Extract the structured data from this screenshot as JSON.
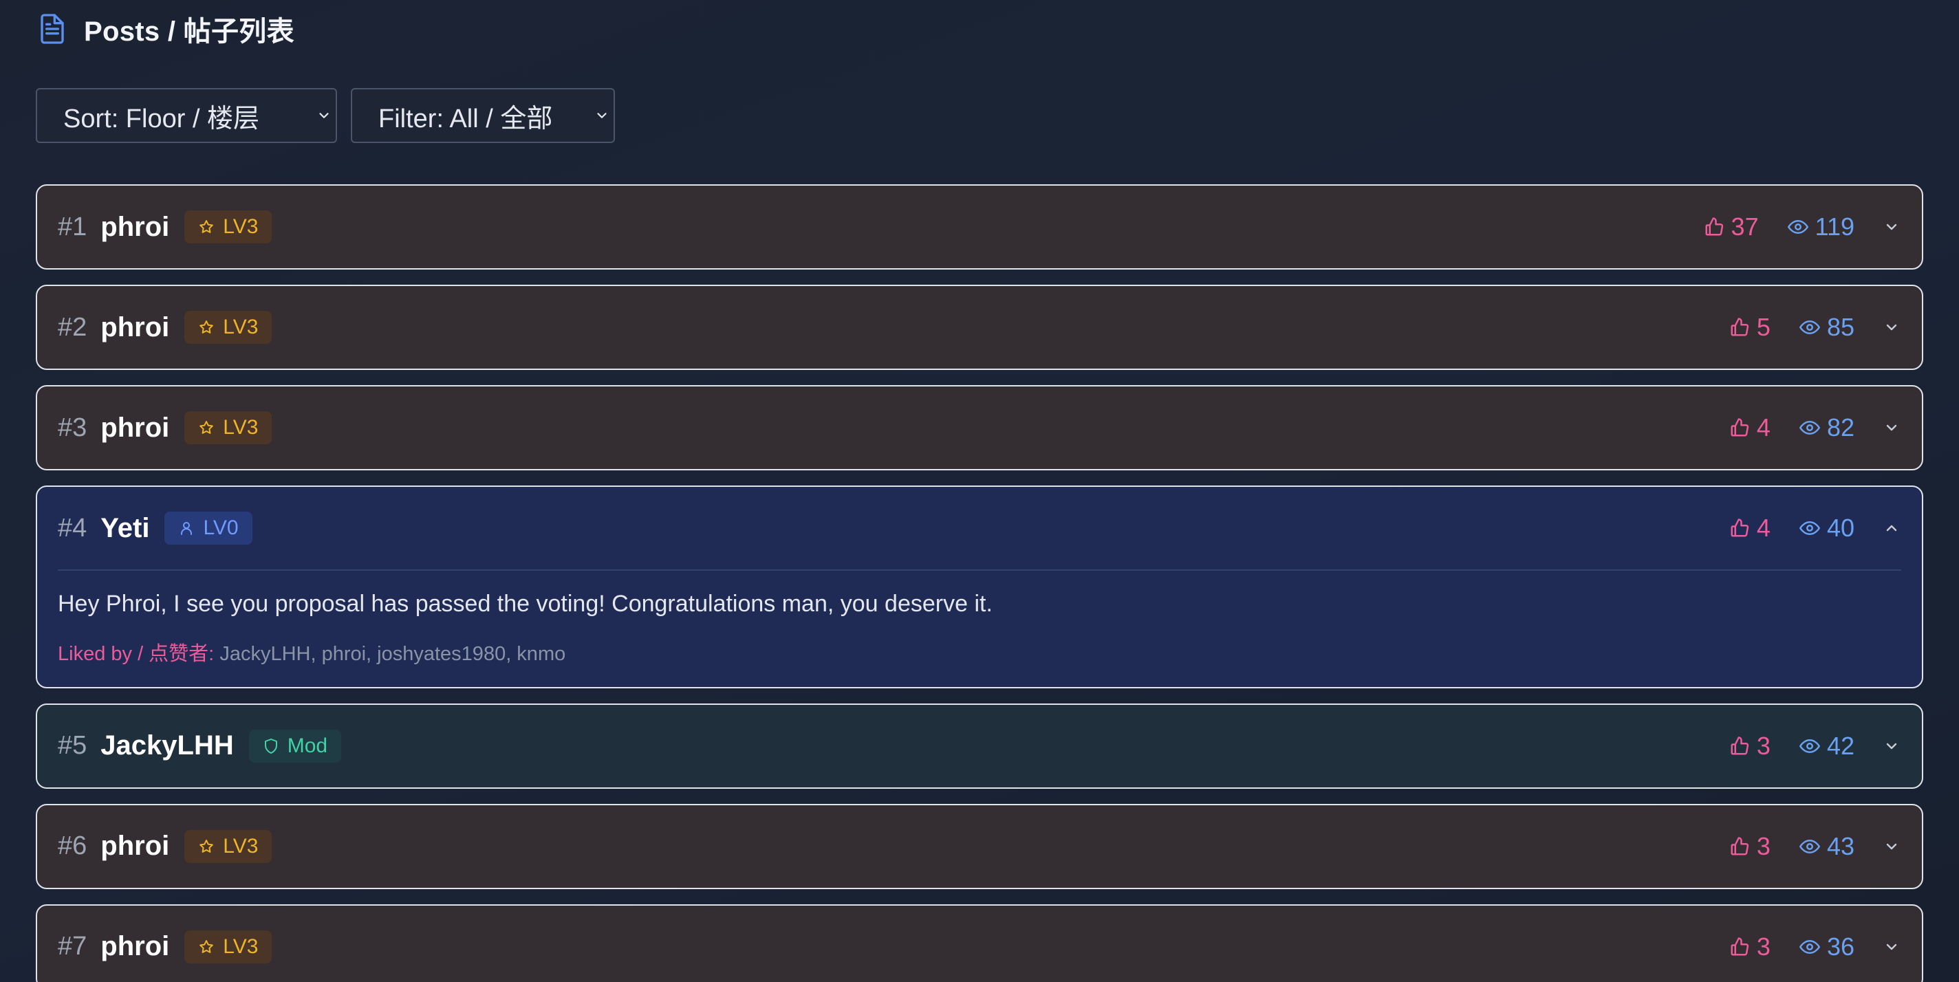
{
  "header": {
    "title": "Posts / 帖子列表",
    "icon": "document-icon"
  },
  "controls": {
    "sort": {
      "value": "Sort: Floor / 楼层"
    },
    "filter": {
      "value": "Filter: All / 全部"
    }
  },
  "colors": {
    "like": "#ec5c9a",
    "view": "#6aa1f0",
    "level_gold": "#f0b429",
    "level_blue": "#6f9bff",
    "mod_teal": "#3fd3a6"
  },
  "posts": [
    {
      "floor": "#1",
      "author": "phroi",
      "badge": "LV3",
      "badge_icon": "star-icon",
      "likes": "37",
      "views": "119",
      "expanded": false
    },
    {
      "floor": "#2",
      "author": "phroi",
      "badge": "LV3",
      "badge_icon": "star-icon",
      "likes": "5",
      "views": "85",
      "expanded": false
    },
    {
      "floor": "#3",
      "author": "phroi",
      "badge": "LV3",
      "badge_icon": "star-icon",
      "likes": "4",
      "views": "82",
      "expanded": false
    },
    {
      "floor": "#4",
      "author": "Yeti",
      "badge": "LV0",
      "badge_icon": "user-icon",
      "likes": "4",
      "views": "40",
      "expanded": true,
      "content": "Hey Phroi, I see you proposal has passed the voting! Congratulations man, you deserve it.",
      "liked_by_label": "Liked by / 点赞者:",
      "liked_by": "JackyLHH, phroi, joshyates1980, knmo"
    },
    {
      "floor": "#5",
      "author": "JackyLHH",
      "badge": "Mod",
      "badge_icon": "shield-icon",
      "likes": "3",
      "views": "42",
      "expanded": false
    },
    {
      "floor": "#6",
      "author": "phroi",
      "badge": "LV3",
      "badge_icon": "star-icon",
      "likes": "3",
      "views": "43",
      "expanded": false
    },
    {
      "floor": "#7",
      "author": "phroi",
      "badge": "LV3",
      "badge_icon": "star-icon",
      "likes": "3",
      "views": "36",
      "expanded": false
    }
  ]
}
